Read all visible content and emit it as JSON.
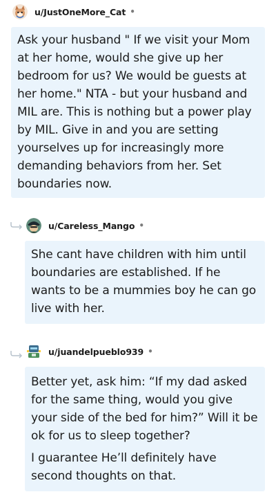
{
  "comments": [
    {
      "username": "u/JustOneMore_Cat",
      "dot": "•",
      "avatar_icon": "cat-avatar-icon",
      "paragraphs": [
        "Ask your husband \" If we visit your Mom at her home, would she give up her bedroom for us? We would be guests at her home.\" NTA - but your husband and MIL are. This is nothing but a power play by MIL. Give in and you are setting yourselves up for increasingly more demanding behaviors from her. Set boundaries now."
      ]
    },
    {
      "username": "u/Careless_Mango",
      "dot": "•",
      "avatar_icon": "mango-avatar-icon",
      "reply_icon": "reply-arrow-icon",
      "paragraphs": [
        "She cant have children with him until boundaries are established. If he wants to be a mummies boy he can go live with her."
      ]
    },
    {
      "username": "u/juandelpueblo939",
      "dot": "•",
      "avatar_icon": "robot-avatar-icon",
      "reply_icon": "reply-arrow-icon",
      "paragraphs": [
        "Better yet, ask him: “If my dad asked for the same thing, would you give your side of the bed for him?” Will it be ok for us to sleep together?",
        "I guarantee He’ll definitely have second thoughts on that."
      ]
    }
  ],
  "colors": {
    "bubble_bg": "#eaf4fc",
    "text": "#1c1c1c",
    "meta": "#7c7c7c"
  }
}
